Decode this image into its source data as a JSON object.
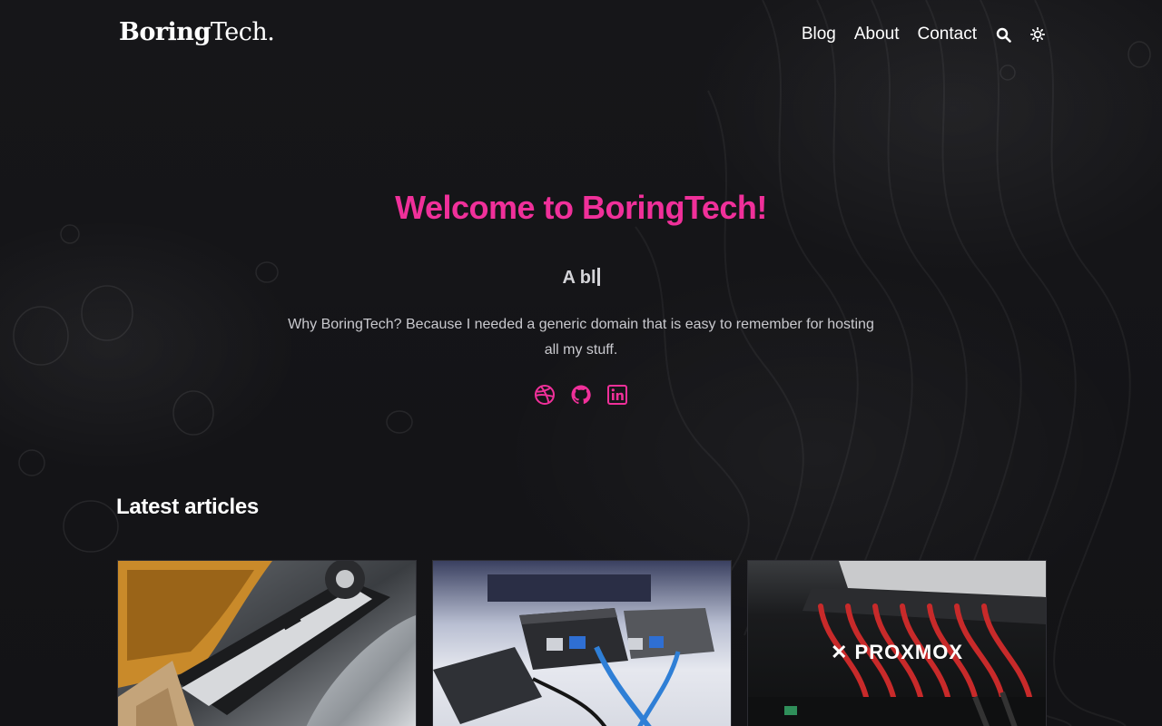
{
  "header": {
    "logo_bold": "Boring",
    "logo_light": "Tech.",
    "nav": [
      {
        "label": "Blog"
      },
      {
        "label": "About"
      },
      {
        "label": "Contact"
      }
    ],
    "icons": [
      "search-icon",
      "theme-toggle-icon"
    ]
  },
  "hero": {
    "title": "Welcome to BoringTech!",
    "typed_text": "A bl",
    "intro": "Why BoringTech? Because I needed a generic domain that is easy to remember for hosting all my stuff.",
    "accent_color": "#f0309a",
    "socials": [
      "dribbble-icon",
      "github-icon",
      "linkedin-icon"
    ]
  },
  "articles": {
    "section_title": "Latest articles",
    "cards": [
      {
        "image": "hard-drive-photo"
      },
      {
        "image": "raspberry-pi-photo"
      },
      {
        "image": "proxmox-server-photo",
        "overlay_text": "PROXMOX"
      }
    ]
  }
}
